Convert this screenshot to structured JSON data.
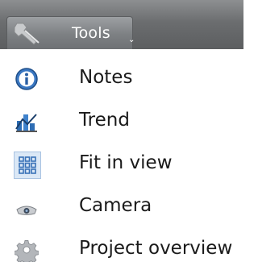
{
  "toolbar": {
    "tools_label": "Tools",
    "caret": "⌄"
  },
  "menu": {
    "items": [
      {
        "label": "Notes",
        "icon": "info-icon"
      },
      {
        "label": "Trend",
        "icon": "trend-chart-icon"
      },
      {
        "label": "Fit in view",
        "icon": "grid-fit-icon",
        "selected": true
      },
      {
        "label": "Camera",
        "icon": "camera-icon"
      },
      {
        "label": "Project overview",
        "icon": "gear-icon"
      }
    ]
  },
  "colors": {
    "toolbar_bg": "#6b6d6f",
    "selected_icon_bg": "#dbe8f6",
    "text": "#1a1a1a",
    "accent_blue": "#2f6fb5"
  }
}
